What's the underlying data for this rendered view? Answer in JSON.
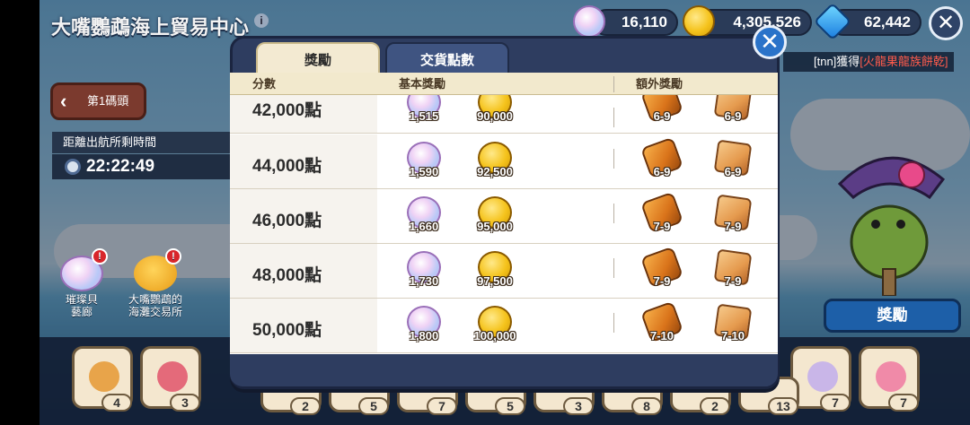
{
  "header": {
    "title": "大嘴鸚鵡海上貿易中心",
    "info": "i",
    "resources": [
      {
        "name": "pearl",
        "value": "16,110"
      },
      {
        "name": "coin",
        "value": "4,305,526"
      },
      {
        "name": "crystal",
        "value": "62,442"
      }
    ],
    "close": "✕"
  },
  "left_panel": {
    "pier_button": "第1碼頭",
    "remaining_label": "距離出航所剩時間",
    "remaining_time": "22:22:49",
    "shortcuts": [
      {
        "label1": "璀璨貝",
        "label2": "藝廊",
        "alert": "!"
      },
      {
        "label1": "大嘴鸚鵡的",
        "label2": "海灘交易所",
        "alert": "!"
      }
    ]
  },
  "right_panel": {
    "ticker_user": "[tnn]獲得",
    "ticker_item": "[火龍果龍族餅乾]",
    "reward_button": "獎勵"
  },
  "bottom_items": [
    {
      "count": "4"
    },
    {
      "count": "3"
    },
    {
      "count": "2"
    },
    {
      "count": "5"
    },
    {
      "count": "7"
    },
    {
      "count": "5"
    },
    {
      "count": "3"
    },
    {
      "count": "8"
    },
    {
      "count": "2"
    },
    {
      "count": "13"
    },
    {
      "count": "7"
    },
    {
      "count": "7"
    }
  ],
  "modal": {
    "tabs": {
      "active": "獎勵",
      "inactive": "交貨點數"
    },
    "close": "✕",
    "columns": {
      "score": "分數",
      "basic": "基本獎勵",
      "extra": "額外獎勵"
    },
    "rows": [
      {
        "score": "42,000點",
        "pearl": "1,515",
        "coin": "90,000",
        "scope": "6-9",
        "chart": "6-9"
      },
      {
        "score": "44,000點",
        "pearl": "1,590",
        "coin": "92,500",
        "scope": "6-9",
        "chart": "6-9"
      },
      {
        "score": "46,000點",
        "pearl": "1,660",
        "coin": "95,000",
        "scope": "7-9",
        "chart": "7-9"
      },
      {
        "score": "48,000點",
        "pearl": "1,730",
        "coin": "97,500",
        "scope": "7-9",
        "chart": "7-9"
      },
      {
        "score": "50,000點",
        "pearl": "1,800",
        "coin": "100,000",
        "scope": "7-10",
        "chart": "7-10"
      }
    ]
  },
  "colors": {
    "modal_bg": "#2e3d60",
    "tab_active": "#f3ead2",
    "tab_inactive": "#3f5481",
    "close_blue": "#2a73c9",
    "highlight_red": "#ff5b4c"
  }
}
